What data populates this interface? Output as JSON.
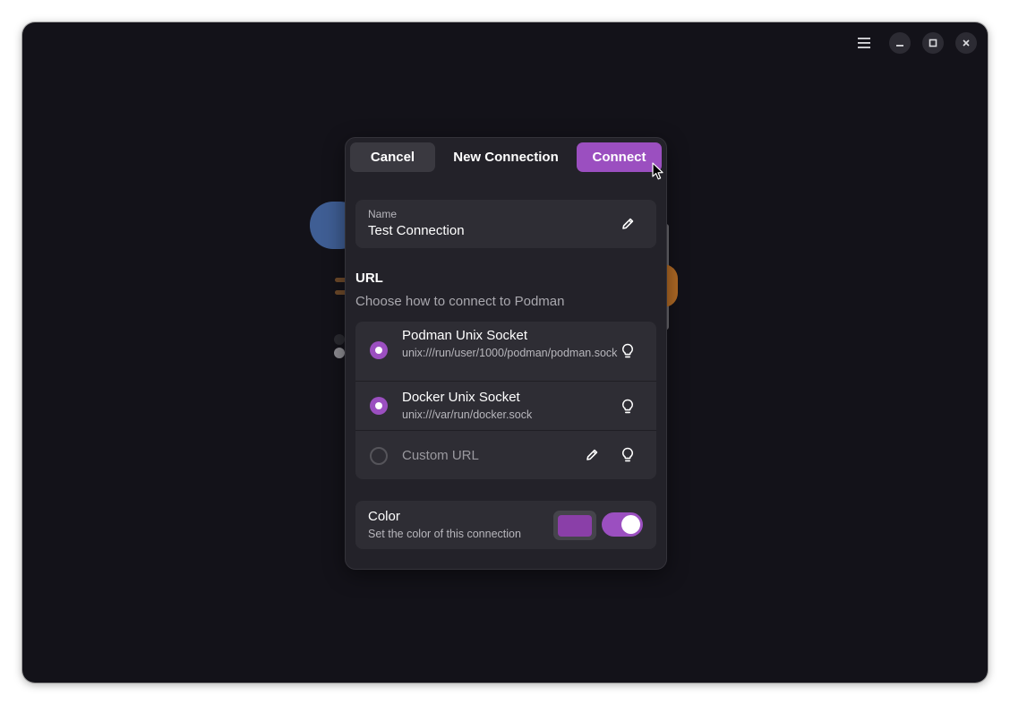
{
  "window": {
    "controls": {
      "menu_icon": "hamburger-menu-icon",
      "minimize_icon": "minimize-icon",
      "maximize_icon": "maximize-icon",
      "close_icon": "close-icon"
    }
  },
  "dialog": {
    "cancel_label": "Cancel",
    "title": "New Connection",
    "connect_label": "Connect",
    "name_field": {
      "label": "Name",
      "value": "Test Connection",
      "edit_icon": "pencil-icon"
    },
    "url_section": {
      "title": "URL",
      "subtitle": "Choose how to connect to Podman",
      "options": [
        {
          "title": "Podman Unix Socket",
          "subtitle": "unix:///run/user/1000/podman/podman.sock",
          "selected": true,
          "icon": "lightbulb-icon"
        },
        {
          "title": "Docker Unix Socket",
          "subtitle": "unix:///var/run/docker.sock",
          "selected": true,
          "icon": "lightbulb-icon"
        },
        {
          "placeholder": "Custom URL",
          "selected": false,
          "icons": [
            "pencil-icon",
            "lightbulb-icon"
          ]
        }
      ]
    },
    "color_section": {
      "title": "Color",
      "subtitle": "Set the color of this connection",
      "swatch_color": "#8a3fa8",
      "toggle_on": true
    }
  },
  "colors": {
    "accent": "#9b4fc0",
    "window_bg": "#131219",
    "dialog_bg": "#232229",
    "card_bg": "#2e2d34"
  }
}
